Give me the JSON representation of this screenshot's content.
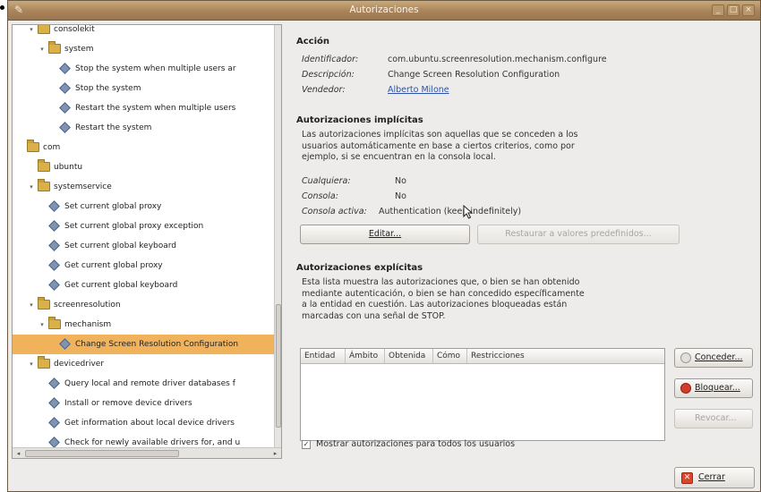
{
  "window": {
    "title": "Autorizaciones",
    "menu_glyph": "✎",
    "controls": [
      "_",
      "□",
      "×"
    ]
  },
  "tree": {
    "rows": [
      {
        "label": "consolekit",
        "kind": "folder",
        "indent": 1,
        "expander": "▾",
        "selected": false
      },
      {
        "label": "system",
        "kind": "folder",
        "indent": 2,
        "expander": "▾",
        "selected": false
      },
      {
        "label": "Stop the system when multiple users ar",
        "kind": "action",
        "indent": 3,
        "selected": false
      },
      {
        "label": "Stop the system",
        "kind": "action",
        "indent": 3,
        "selected": false
      },
      {
        "label": "Restart the system when multiple users",
        "kind": "action",
        "indent": 3,
        "selected": false
      },
      {
        "label": "Restart the system",
        "kind": "action",
        "indent": 3,
        "selected": false
      },
      {
        "label": "com",
        "kind": "folder",
        "indent": 0,
        "expander": "",
        "selected": false
      },
      {
        "label": "ubuntu",
        "kind": "folder",
        "indent": 1,
        "expander": "",
        "selected": false
      },
      {
        "label": "systemservice",
        "kind": "folder",
        "indent": 1,
        "expander": "▾",
        "selected": false
      },
      {
        "label": "Set current global proxy",
        "kind": "action",
        "indent": 2,
        "selected": false
      },
      {
        "label": "Set current global proxy exception",
        "kind": "action",
        "indent": 2,
        "selected": false
      },
      {
        "label": "Set current global keyboard",
        "kind": "action",
        "indent": 2,
        "selected": false
      },
      {
        "label": "Get current global proxy",
        "kind": "action",
        "indent": 2,
        "selected": false
      },
      {
        "label": "Get current global keyboard",
        "kind": "action",
        "indent": 2,
        "selected": false
      },
      {
        "label": "screenresolution",
        "kind": "folder",
        "indent": 1,
        "expander": "▾",
        "selected": false
      },
      {
        "label": "mechanism",
        "kind": "folder",
        "indent": 2,
        "expander": "▾",
        "selected": false
      },
      {
        "label": "Change Screen Resolution Configuration",
        "kind": "action",
        "indent": 3,
        "selected": true
      },
      {
        "label": "devicedriver",
        "kind": "folder",
        "indent": 1,
        "expander": "▾",
        "selected": false
      },
      {
        "label": "Query local and remote driver databases f",
        "kind": "action",
        "indent": 2,
        "selected": false
      },
      {
        "label": "Install or remove device drivers",
        "kind": "action",
        "indent": 2,
        "selected": false
      },
      {
        "label": "Get information about local device drivers",
        "kind": "action",
        "indent": 2,
        "selected": false
      },
      {
        "label": "Check for newly available drivers for, and u",
        "kind": "action",
        "indent": 2,
        "selected": false
      }
    ],
    "hscroll_left": "◂",
    "hscroll_right": "▸"
  },
  "action": {
    "heading": "Acción",
    "identifier_label": "Identificador:",
    "identifier_value": "com.ubuntu.screenresolution.mechanism.configure",
    "description_label": "Descripción:",
    "description_value": "Change Screen Resolution Configuration",
    "vendor_label": "Vendedor:",
    "vendor_value": "Alberto Milone"
  },
  "implicit": {
    "heading": "Autorizaciones implícitas",
    "text": "Las autorizaciones implícitas son aquellas que se conceden a los usuarios automáticamente en base a ciertos criterios, como por ejemplo, si se encuentran en la consola local.",
    "any_label": "Cualquiera:",
    "any_value": "No",
    "console_label": "Consola:",
    "console_value": "No",
    "active_label": "Consola activa:",
    "active_value": "Authentication (keep indefinitely)",
    "edit_button": "Editar...",
    "restore_button": "Restaurar a valores predefinidos..."
  },
  "explicit": {
    "heading": "Autorizaciones explícitas",
    "text": "Esta lista muestra las autorizaciones que, o bien se han obtenido mediante autenticación, o bien se han concedido específicamente a la entidad en cuestión. Las autorizaciones bloqueadas están marcadas con una señal de STOP.",
    "columns": [
      "Entidad",
      "Ámbito",
      "Obtenida",
      "Cómo",
      "Restricciones"
    ],
    "grant_button": "Conceder...",
    "block_button": "Bloquear...",
    "revoke_button": "Revocar...",
    "show_all_checkbox": "Mostrar autorizaciones para todos los usuarios",
    "show_all_checked": true,
    "close_button": "Cerrar"
  }
}
